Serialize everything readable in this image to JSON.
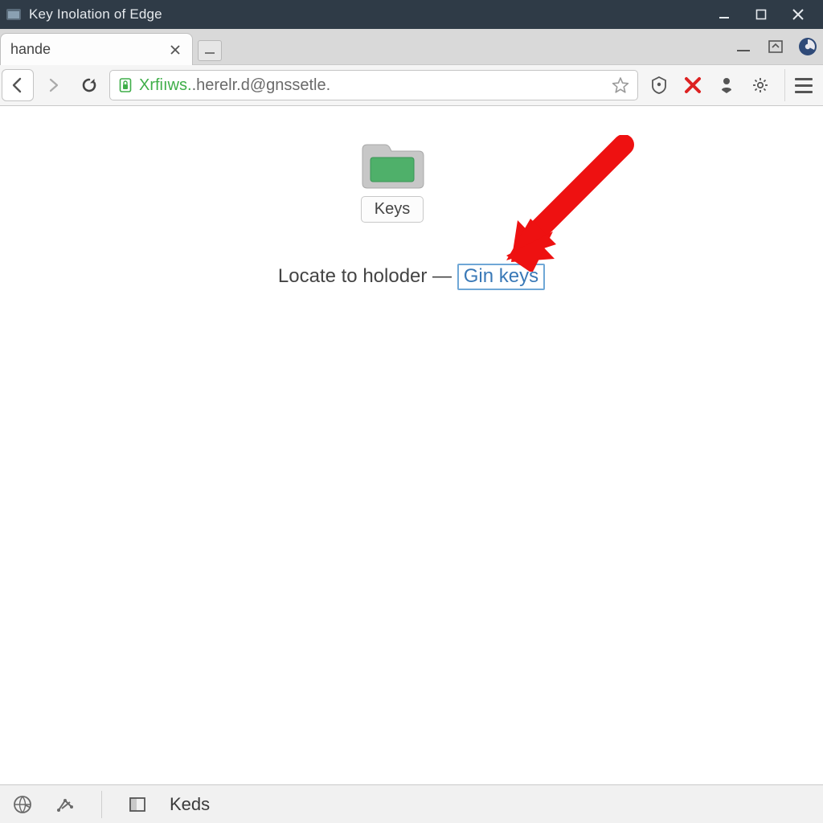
{
  "window": {
    "title": "Key Inolation of Edge"
  },
  "tabs": {
    "active_title": "hande"
  },
  "address": {
    "url_prefix": "Xrfiıws.",
    "url_rest": ".herelr.d@gnssetle."
  },
  "content": {
    "folder_label": "Keys",
    "prompt_text": "Locate to holoder — ",
    "link_text": "Gin keys"
  },
  "statusbar": {
    "label": "Keds"
  }
}
